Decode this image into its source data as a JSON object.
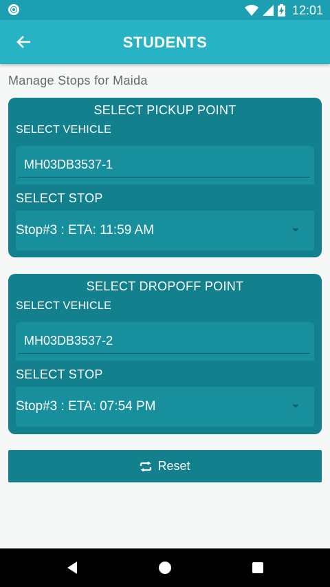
{
  "status_bar": {
    "time": "12:01",
    "icons": [
      "app-notification-icon",
      "wifi-icon",
      "signal-icon",
      "battery-charging-icon"
    ]
  },
  "app_bar": {
    "title": "STUDENTS",
    "back_icon": "arrow-left-icon"
  },
  "subtitle": "Manage Stops for Maida",
  "pickup": {
    "title": "SELECT PICKUP POINT",
    "vehicle_label": "SELECT VEHICLE",
    "vehicle_value": "MH03DB3537-1",
    "stop_label": "SELECT STOP",
    "stop_value": "Stop#3 : ETA: 11:59 AM"
  },
  "dropoff": {
    "title": "SELECT DROPOFF POINT",
    "vehicle_label": "SELECT VEHICLE",
    "vehicle_value": "MH03DB3537-2",
    "stop_label": "SELECT STOP",
    "stop_value": "Stop#3 : ETA: 07:54 PM"
  },
  "reset_button": {
    "label": "Reset",
    "icon": "refresh-icon"
  },
  "nav_bar": {
    "icons": [
      "back-triangle-icon",
      "home-circle-icon",
      "recents-square-icon"
    ]
  },
  "colors": {
    "status_bar": "#1c9fb0",
    "app_bar": "#27b3c3",
    "card": "#12808d",
    "field": "#178f9d",
    "background": "#f6f7f7"
  }
}
